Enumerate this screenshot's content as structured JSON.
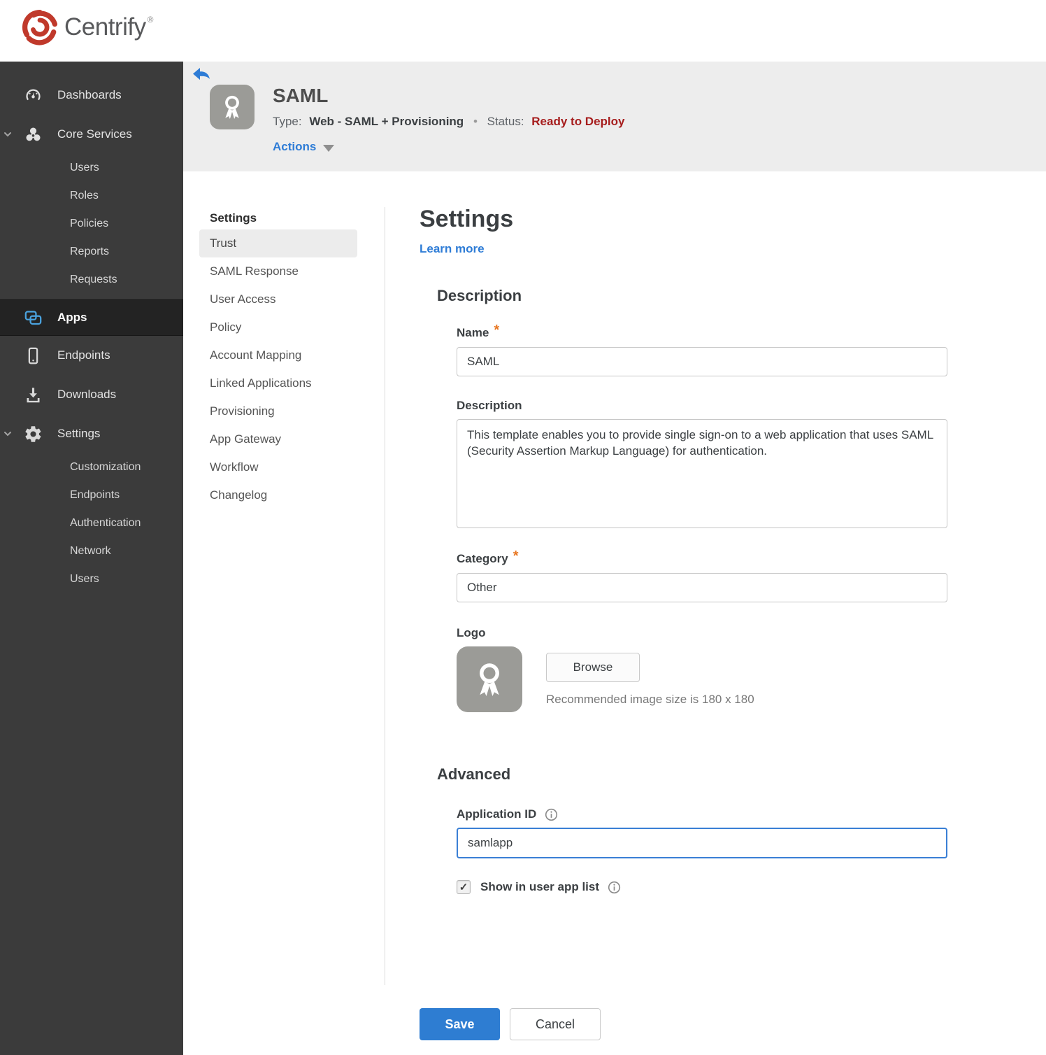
{
  "brand": {
    "name": "Centrify",
    "trademark": "®"
  },
  "sidebar": {
    "items": [
      {
        "label": "Dashboards",
        "icon": "gauge-icon"
      },
      {
        "label": "Core Services",
        "icon": "core-services-icon",
        "expanded": true,
        "children": [
          "Users",
          "Roles",
          "Policies",
          "Reports",
          "Requests"
        ]
      },
      {
        "label": "Apps",
        "icon": "apps-icon",
        "active": true
      },
      {
        "label": "Endpoints",
        "icon": "mobile-device-icon"
      },
      {
        "label": "Downloads",
        "icon": "download-icon"
      },
      {
        "label": "Settings",
        "icon": "gear-icon",
        "expanded": true,
        "children": [
          "Customization",
          "Endpoints",
          "Authentication",
          "Network",
          "Users"
        ]
      }
    ]
  },
  "app_header": {
    "title": "SAML",
    "type_label": "Type:",
    "type_value": "Web - SAML + Provisioning",
    "separator": "•",
    "status_label": "Status:",
    "status_value": "Ready to Deploy",
    "actions_label": "Actions"
  },
  "subnav": {
    "heading": "Settings",
    "active_item": "Trust",
    "items": [
      "Trust",
      "SAML Response",
      "User Access",
      "Policy",
      "Account Mapping",
      "Linked Applications",
      "Provisioning",
      "App Gateway",
      "Workflow",
      "Changelog"
    ]
  },
  "main": {
    "heading": "Settings",
    "learn_more_label": "Learn more",
    "required_marker": "*",
    "description": {
      "heading": "Description",
      "name_label": "Name",
      "name_value": "SAML",
      "description_label": "Description",
      "description_value": "This template enables you to provide single sign-on to a web application that uses SAML (Security Assertion Markup Language) for authentication.",
      "category_label": "Category",
      "category_value": "Other",
      "logo_label": "Logo",
      "browse_label": "Browse",
      "logo_hint": "Recommended image size is 180 x 180"
    },
    "advanced": {
      "heading": "Advanced",
      "application_id_label": "Application ID",
      "application_id_value": "samlapp",
      "show_in_user_app_list_label": "Show in user app list",
      "checkbox_checked": true,
      "checkbox_glyph": "✓"
    },
    "footer": {
      "save_label": "Save",
      "cancel_label": "Cancel"
    }
  },
  "colors": {
    "accent_blue": "#2e7dd2",
    "link_blue": "#2e7cd6",
    "status_red": "#a61d1d",
    "required_orange": "#e87722",
    "sidebar_bg": "#3b3b3b",
    "sidebar_active_bg": "#232323",
    "header_band_gray": "#ededed",
    "apps_icon_blue": "#4aa3df",
    "brand_red": "#c0392b",
    "focused_input_border": "#3a7fd5"
  }
}
